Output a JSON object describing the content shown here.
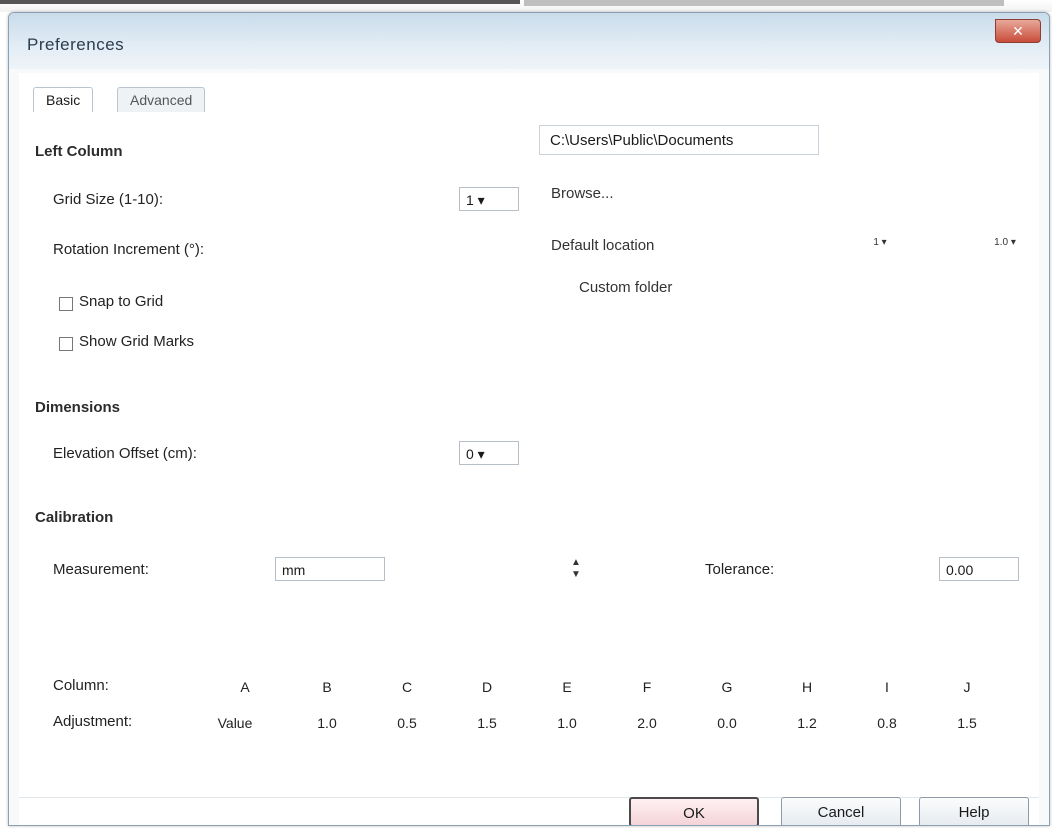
{
  "window": {
    "title": "Preferences",
    "close_label": "✕"
  },
  "tabs": [
    "Basic",
    "Advanced"
  ],
  "sections": {
    "s1": "Left Column",
    "s2": "Dimensions",
    "s3": "Calibration"
  },
  "fields": {
    "grid_size_label": "Grid Size (1-10):",
    "grid_size_value": "1 ▾",
    "rotation_label": "Rotation Increment (°):",
    "rotation_value": "",
    "check1": "Snap to Grid",
    "check2": "Show Grid Marks",
    "elevation_label": "Elevation Offset (cm):",
    "elevation_value": "0 ▾",
    "measure_label": "Measurement:",
    "measure_value": "mm",
    "tolerance_label": "Tolerance:",
    "tolerance_value": "0.00"
  },
  "right": {
    "path": "C:\\Users\\Public\\Documents",
    "opt1": "Browse...",
    "opt2": "Default location",
    "opt3": "Custom folder",
    "spin_a": "1 ▾",
    "spin_b": "1.0 ▾"
  },
  "table": {
    "row1_label": "Column:",
    "row2_label": "Adjustment:",
    "row1": [
      "A",
      "B",
      "C",
      "D",
      "E",
      "F",
      "G",
      "H",
      "I",
      "J"
    ],
    "row2": [
      "Value",
      "1.0",
      "0.5",
      "1.5",
      "1.0",
      "2.0",
      "0.0",
      "1.2",
      "0.8",
      "1.5"
    ]
  },
  "buttons": {
    "ok": "OK",
    "cancel": "Cancel",
    "help": "Help"
  }
}
